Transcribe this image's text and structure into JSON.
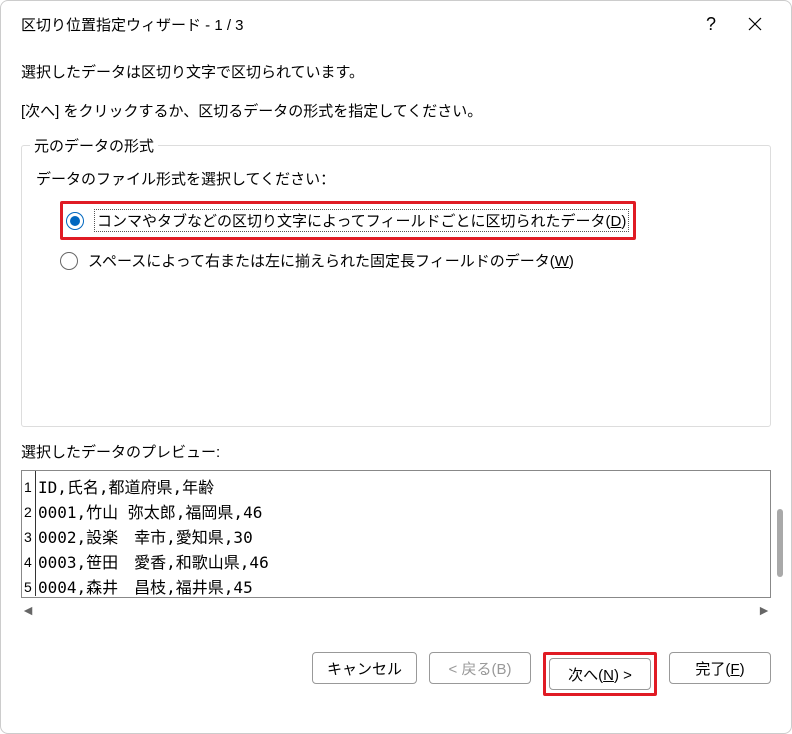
{
  "titlebar": {
    "title": "区切り位置指定ウィザード - 1 / 3"
  },
  "message1": "選択したデータは区切り文字で区切られています。",
  "message2": "[次へ] をクリックするか、区切るデータの形式を指定してください。",
  "groupbox": {
    "title": "元のデータの形式",
    "prompt": "データのファイル形式を選択してください：",
    "option1_prefix": "コンマやタブなどの区切り文字によってフィールドごとに区切られたデータ(",
    "option1_key": "D",
    "option1_suffix": ")",
    "option2_prefix": "スペースによって右または左に揃えられた固定長フィールドのデータ(",
    "option2_key": "W",
    "option2_suffix": ")"
  },
  "preview": {
    "label": "選択したデータのプレビュー:",
    "rows": [
      {
        "n": "1",
        "text": "ID,氏名,都道府県,年齢"
      },
      {
        "n": "2",
        "text": "0001,竹山 弥太郎,福岡県,46"
      },
      {
        "n": "3",
        "text": "0002,設楽　幸市,愛知県,30"
      },
      {
        "n": "4",
        "text": "0003,笹田　愛香,和歌山県,46"
      },
      {
        "n": "5",
        "text": "0004,森井　昌枝,福井県,45"
      }
    ]
  },
  "buttons": {
    "cancel": "キャンセル",
    "back": "< 戻る(B)",
    "next_prefix": "次へ(",
    "next_key": "N",
    "next_suffix": ") >",
    "finish_prefix": "完了(",
    "finish_key": "F",
    "finish_suffix": ")"
  }
}
